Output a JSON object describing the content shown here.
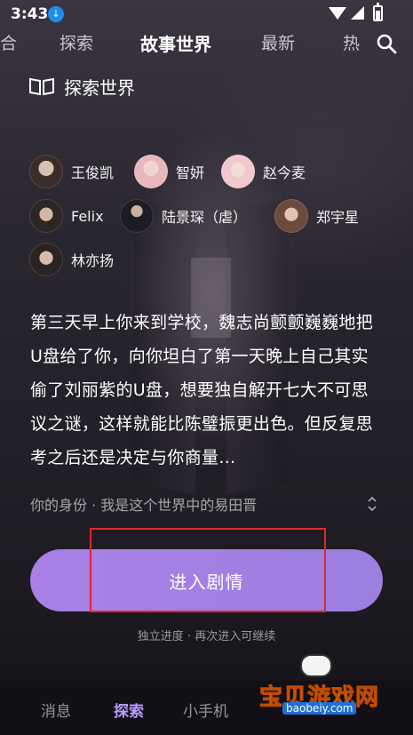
{
  "status_bar": {
    "time": "3:43"
  },
  "top_tabs": [
    {
      "label": "合",
      "active": false
    },
    {
      "label": "探索",
      "active": false
    },
    {
      "label": "故事世界",
      "active": true
    },
    {
      "label": "最新",
      "active": false
    },
    {
      "label": "热",
      "active": false
    }
  ],
  "section": {
    "title": "探索世界"
  },
  "characters": [
    {
      "name": "王俊凯"
    },
    {
      "name": "智妍"
    },
    {
      "name": "赵今麦"
    },
    {
      "name": "Felix"
    },
    {
      "name": "陆景琛（虐）"
    },
    {
      "name": "郑宇星"
    },
    {
      "name": "林亦扬"
    }
  ],
  "story": {
    "text": "第三天早上你来到学校，魏志尚颤颤巍巍地把U盘给了你，向你坦白了第一天晚上自己其实偷了刘丽紫的U盘，想要独自解开七大不可思议之谜，这样就能比陈璧振更出色。但反复思考之后还是决定与你商量…"
  },
  "identity": {
    "text": "你的身份 · 我是这个世界中的易田晋"
  },
  "enter_button": {
    "label": "进入剧情"
  },
  "hint": {
    "text": "独立进度 · 再次进入可继续"
  },
  "bottom_nav": [
    {
      "label": "消息",
      "active": false
    },
    {
      "label": "探索",
      "active": true
    },
    {
      "label": "小手机",
      "active": false
    }
  ],
  "watermark": {
    "title": "宝贝游戏网",
    "url": "baobeiy.com"
  },
  "colors": {
    "accent": "#a880e6",
    "active_tab_nav": "#b99cff",
    "highlight_box": "#e0282a",
    "watermark_yellow": "#ffdf3a"
  }
}
